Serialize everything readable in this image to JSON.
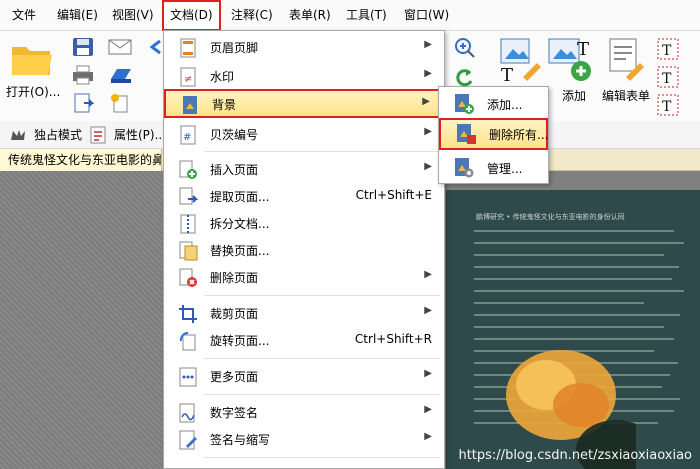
{
  "menubar": {
    "items": [
      "文件",
      "编辑(E)",
      "视图(V)",
      "文档(D)",
      "注释(C)",
      "表单(R)",
      "工具(T)",
      "窗口(W)"
    ]
  },
  "ribbon": {
    "open_label": "打开(O)...",
    "add_label": "添加",
    "edit_form_label": "编辑表单"
  },
  "subbar": {
    "exclusive_mode": "独占模式",
    "properties": "属性(P)..."
  },
  "tab": {
    "title": "传统鬼怪文化与东亚电影的鼻"
  },
  "document_menu": {
    "items": [
      {
        "label": "页眉页脚",
        "arrow": true
      },
      {
        "label": "水印",
        "arrow": true
      },
      {
        "label": "背景",
        "arrow": true
      },
      {
        "label": "贝茨编号",
        "arrow": true
      },
      {
        "label": "插入页面",
        "arrow": true
      },
      {
        "label": "提取页面...",
        "shortcut": "Ctrl+Shift+E"
      },
      {
        "label": "拆分文档..."
      },
      {
        "label": "替换页面..."
      },
      {
        "label": "删除页面",
        "arrow": true
      },
      {
        "label": "裁剪页面",
        "arrow": true
      },
      {
        "label": "旋转页面...",
        "shortcut": "Ctrl+Shift+R"
      },
      {
        "label": "更多页面",
        "arrow": true
      },
      {
        "label": "数字签名",
        "arrow": true
      },
      {
        "label": "签名与缩写",
        "arrow": true
      }
    ]
  },
  "background_submenu": {
    "items": [
      "添加...",
      "删除所有...",
      "管理..."
    ]
  },
  "page": {
    "header": "鹏博研究 • 传统鬼怪文化与东亚电影的身份认同"
  },
  "watermark": "https://blog.csdn.net/zsxiaoxiaoxiao",
  "colors": {
    "highlight_border": "#e02020",
    "menu_highlight": "#ffe38a",
    "tab_bar": "#f1e9c9"
  }
}
